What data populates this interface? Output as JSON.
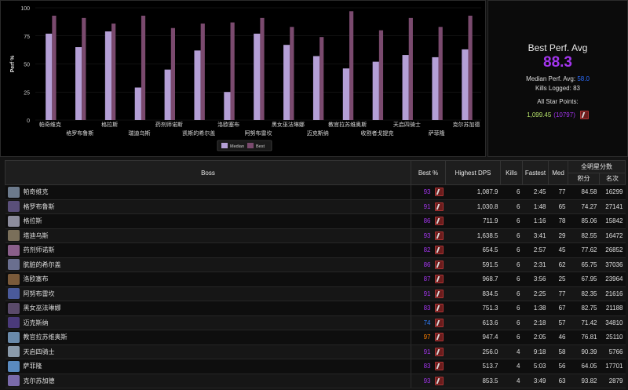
{
  "chart_data": {
    "type": "bar",
    "ylabel": "Perf %",
    "ylim": [
      0,
      100
    ],
    "yticks": [
      0,
      25,
      50,
      75,
      100
    ],
    "categories": [
      "帕奇维克",
      "格罗布鲁斯",
      "格拉斯",
      "瑞迪乌斯",
      "药剂师诺斯",
      "凯斯的希尔盖",
      "洛欧塞布",
      "阿努布雷坎",
      "黑女巫法琳娜",
      "迈克斯纳",
      "教官拉苏维奥斯",
      "收割者戈提克",
      "天启四骑士",
      "萨菲隆",
      "克尔苏加德"
    ],
    "series": [
      {
        "name": "Median",
        "values": [
          77,
          65,
          79,
          29,
          45,
          62,
          25,
          77,
          67,
          57,
          46,
          52,
          58,
          56,
          63
        ],
        "color": "#b49fd6"
      },
      {
        "name": "Best",
        "values": [
          93,
          91,
          86,
          93,
          82,
          86,
          87,
          91,
          83,
          74,
          97,
          80,
          91,
          83,
          93
        ],
        "color": "#7a4a6e"
      }
    ],
    "legend": "bottom-center"
  },
  "summary": {
    "title": "Best Perf. Avg",
    "value": "88.3",
    "median_label": "Median Perf. Avg:",
    "median_value": "58.0",
    "kills_label": "Kills Logged:",
    "kills_value": "83",
    "star_label": "All Star Points:",
    "star_points": "1,099.45",
    "star_rank": "(10797)"
  },
  "table": {
    "headers": {
      "boss": "Boss",
      "best": "Best %",
      "dps": "Highest DPS",
      "kills": "Kills",
      "fastest": "Fastest",
      "med": "Med",
      "allstar": "全明星分数",
      "points": "积分",
      "rank": "名次"
    },
    "rows": [
      {
        "boss": "帕奇维克",
        "best": "93",
        "dps": "1,087.9",
        "kills": "6",
        "fastest": "2:45",
        "med": "77",
        "points": "84.58",
        "rank": "16299"
      },
      {
        "boss": "格罗布鲁斯",
        "best": "91",
        "dps": "1,030.8",
        "kills": "6",
        "fastest": "1:48",
        "med": "65",
        "points": "74.27",
        "rank": "27141"
      },
      {
        "boss": "格拉斯",
        "best": "86",
        "dps": "711.9",
        "kills": "6",
        "fastest": "1:16",
        "med": "78",
        "points": "85.06",
        "rank": "15842"
      },
      {
        "boss": "塔迪乌斯",
        "best": "93",
        "dps": "1,638.5",
        "kills": "6",
        "fastest": "3:41",
        "med": "29",
        "points": "82.55",
        "rank": "16472"
      },
      {
        "boss": "药剂师诺斯",
        "best": "82",
        "dps": "654.5",
        "kills": "6",
        "fastest": "2:57",
        "med": "45",
        "points": "77.62",
        "rank": "26852"
      },
      {
        "boss": "肮脏的希尔盖",
        "best": "86",
        "dps": "591.5",
        "kills": "6",
        "fastest": "2:31",
        "med": "62",
        "points": "65.75",
        "rank": "37036"
      },
      {
        "boss": "洛欧塞布",
        "best": "87",
        "dps": "968.7",
        "kills": "6",
        "fastest": "3:56",
        "med": "25",
        "points": "67.95",
        "rank": "23964"
      },
      {
        "boss": "阿努布雷坎",
        "best": "91",
        "dps": "834.5",
        "kills": "6",
        "fastest": "2:25",
        "med": "77",
        "points": "82.35",
        "rank": "21616"
      },
      {
        "boss": "黑女巫法琳娜",
        "best": "83",
        "dps": "751.3",
        "kills": "6",
        "fastest": "1:38",
        "med": "67",
        "points": "82.75",
        "rank": "21188"
      },
      {
        "boss": "迈克斯纳",
        "best": "74",
        "dps": "613.6",
        "kills": "6",
        "fastest": "2:18",
        "med": "57",
        "points": "71.42",
        "rank": "34810"
      },
      {
        "boss": "教官拉苏维奥斯",
        "best": "97",
        "dps": "947.4",
        "kills": "6",
        "fastest": "2:05",
        "med": "46",
        "points": "76.81",
        "rank": "25110"
      },
      {
        "boss": "天启四骑士",
        "best": "91",
        "dps": "256.0",
        "kills": "4",
        "fastest": "9:18",
        "med": "58",
        "points": "90.39",
        "rank": "5766"
      },
      {
        "boss": "萨菲隆",
        "best": "83",
        "dps": "513.7",
        "kills": "4",
        "fastest": "5:03",
        "med": "56",
        "points": "64.05",
        "rank": "17701"
      },
      {
        "boss": "克尔苏加德",
        "best": "93",
        "dps": "853.5",
        "kills": "4",
        "fastest": "3:49",
        "med": "63",
        "points": "93.82",
        "rank": "2879"
      }
    ]
  }
}
